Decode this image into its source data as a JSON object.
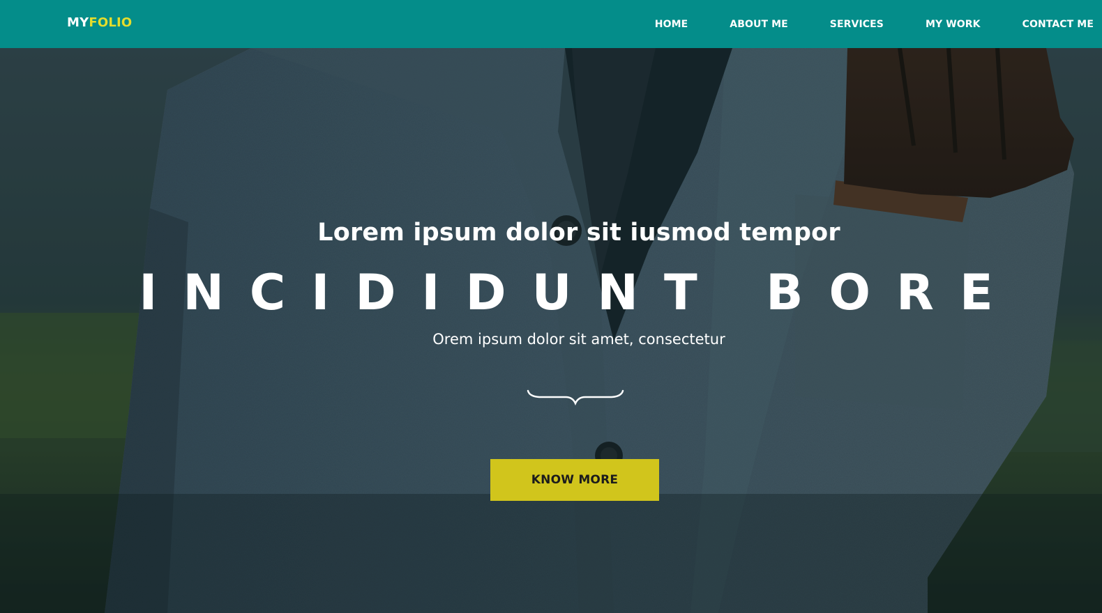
{
  "brand": {
    "part1": "MY",
    "part2": "FOLIO"
  },
  "nav": {
    "items": [
      {
        "label": "HOME"
      },
      {
        "label": "ABOUT ME"
      },
      {
        "label": "SERVICES"
      },
      {
        "label": "MY WORK"
      },
      {
        "label": "CONTACT ME"
      }
    ]
  },
  "hero": {
    "subtitle": "Lorem ipsum dolor sit iusmod tempor",
    "title": "INCIDIDUNT BORE",
    "tagline": "Orem ipsum dolor sit amet, consectetur",
    "cta_label": "KNOW MORE",
    "background_description": "close-up of grey wool coat with leather gloves in pocket"
  },
  "colors": {
    "navbar": "#048d8a",
    "brand_accent": "#e5dd2c",
    "cta_background": "#d1c51c",
    "text_light": "#ffffff"
  },
  "icons": {
    "divider": "curly-brace-divider-icon"
  }
}
